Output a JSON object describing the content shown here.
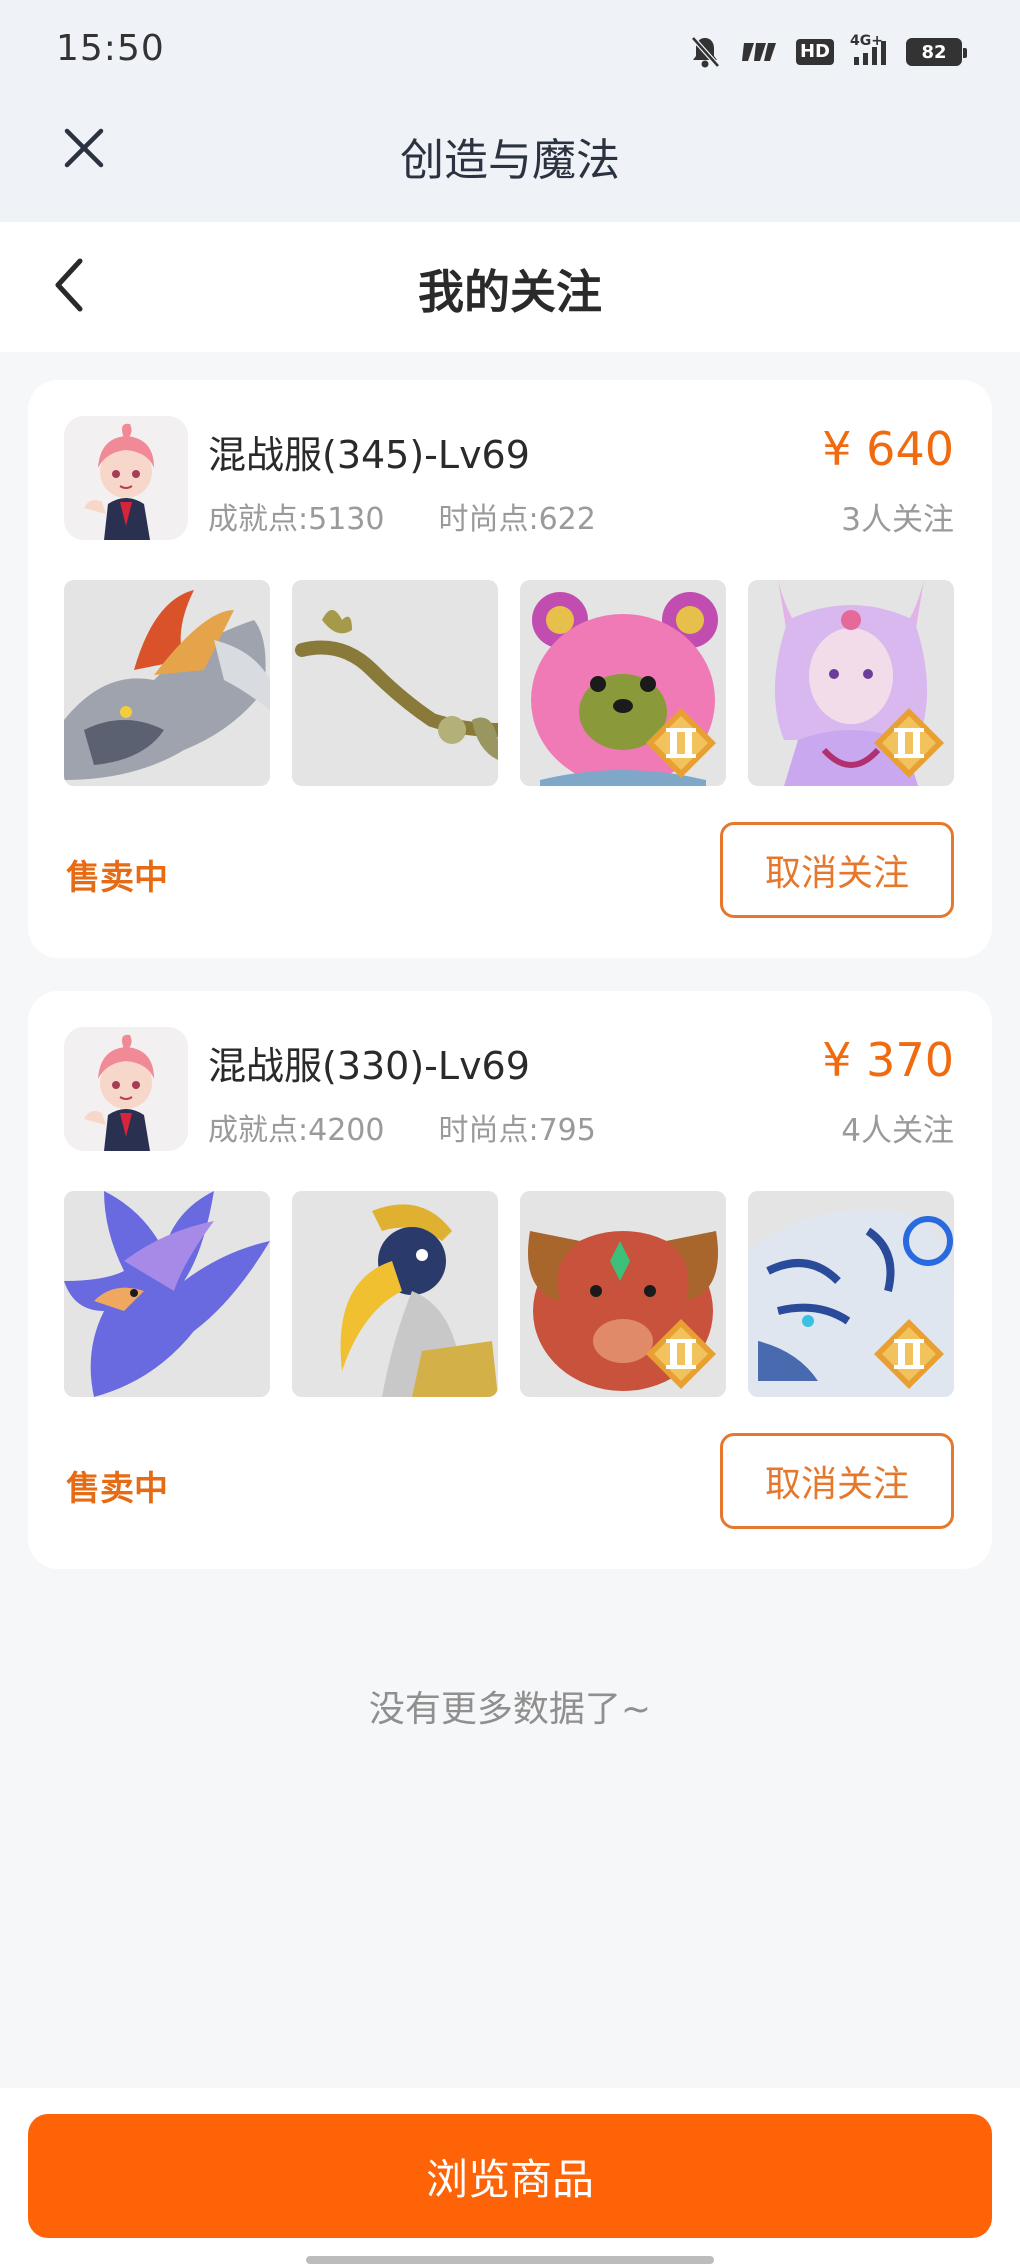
{
  "status_bar": {
    "time": "15:50",
    "hd_label": "HD",
    "network_label": "4G+",
    "battery_level": "82"
  },
  "app_header": {
    "title": "创造与魔法",
    "close_icon": "close-icon"
  },
  "page_header": {
    "title": "我的关注",
    "back_icon": "chevron-left-icon"
  },
  "cards": [
    {
      "server": "混战服(345)-Lv69",
      "achievement": "成就点:5130",
      "fashion": "时尚点:622",
      "price": "¥ 640",
      "followers": "3人关注",
      "status": "售卖中",
      "unfollow_label": "取消关注",
      "items": [
        "dragon-mount",
        "wooden-staff",
        "pink-bear-mount",
        "fox-spirit-mount"
      ]
    },
    {
      "server": "混战服(330)-Lv69",
      "achievement": "成就点:4200",
      "fashion": "时尚点:795",
      "price": "¥ 370",
      "followers": "4人关注",
      "status": "售卖中",
      "unfollow_label": "取消关注",
      "items": [
        "blue-phoenix-mount",
        "hornbill-mount",
        "red-ram-mount",
        "white-tiger-mount"
      ]
    }
  ],
  "list_end_text": "没有更多数据了~",
  "browse_button_label": "浏览商品",
  "colors": {
    "accent_orange": "#fe6308",
    "price_orange": "#f06a10",
    "status_orange": "#e56b15"
  }
}
